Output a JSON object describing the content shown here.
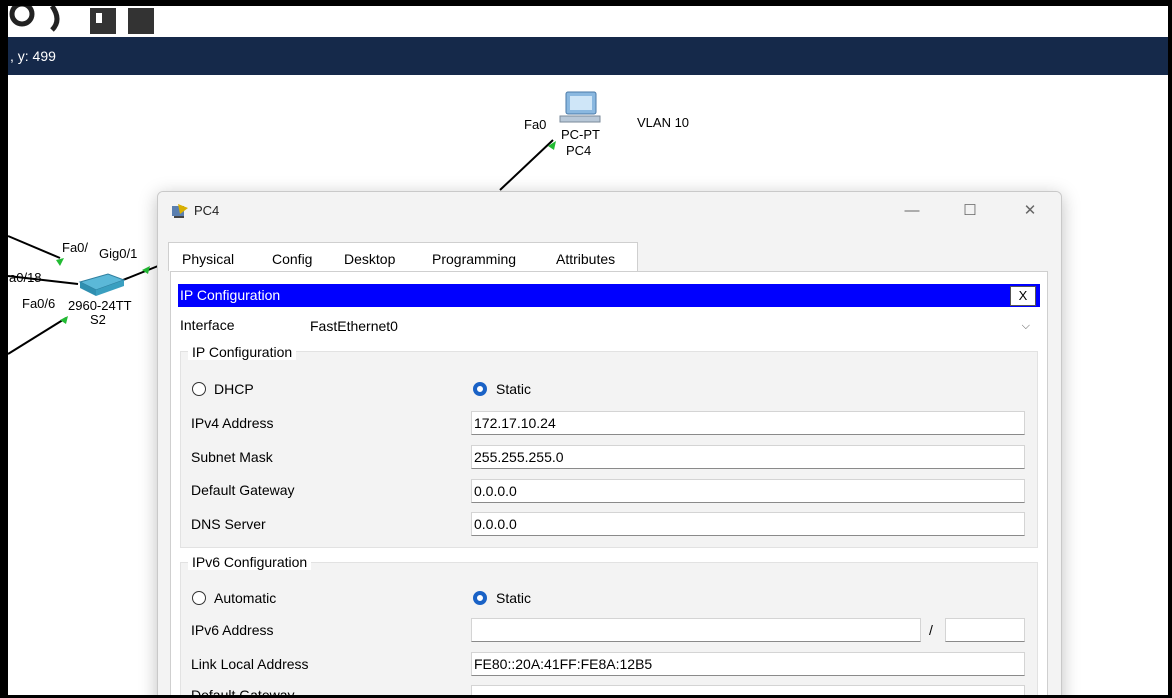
{
  "coord_readout": ", y: 499",
  "topology": {
    "pc_link_label": "Fa0",
    "pc_type": "PC-PT",
    "pc_name": "PC4",
    "vlan_label": "VLAN 10",
    "switch_port_top": "Fa0/",
    "switch_port_gig": "Gig0/1",
    "switch_port_18": "a0/18",
    "switch_port_6": "Fa0/6",
    "switch_model": "2960-24TT",
    "switch_name": "S2"
  },
  "window": {
    "title": "PC4",
    "minimize": "—",
    "maximize": "☐",
    "close": "✕"
  },
  "tabs": [
    {
      "label": "Physical"
    },
    {
      "label": "Config"
    },
    {
      "label": "Desktop",
      "active": true
    },
    {
      "label": "Programming"
    },
    {
      "label": "Attributes"
    }
  ],
  "ip_config": {
    "bar_title": "IP Configuration",
    "close_label": "X",
    "interface_label": "Interface",
    "interface_value": "FastEthernet0",
    "ipv4_group_title": "IP Configuration",
    "dhcp_label": "DHCP",
    "static_label": "Static",
    "ipv4_mode": "static",
    "fields": [
      {
        "label": "IPv4 Address",
        "value": "172.17.10.24"
      },
      {
        "label": "Subnet Mask",
        "value": "255.255.255.0"
      },
      {
        "label": "Default Gateway",
        "value": "0.0.0.0"
      },
      {
        "label": "DNS Server",
        "value": "0.0.0.0"
      }
    ],
    "ipv6_group_title": "IPv6 Configuration",
    "auto_label": "Automatic",
    "static6_label": "Static",
    "ipv6_mode": "static",
    "ipv6_address_label": "IPv6 Address",
    "ipv6_address_value": "",
    "ipv6_prefix_sep": "/",
    "ipv6_prefix_value": "",
    "link_local_label": "Link Local Address",
    "link_local_value": "FE80::20A:41FF:FE8A:12B5",
    "ipv6_gateway_label": "Default Gateway"
  }
}
